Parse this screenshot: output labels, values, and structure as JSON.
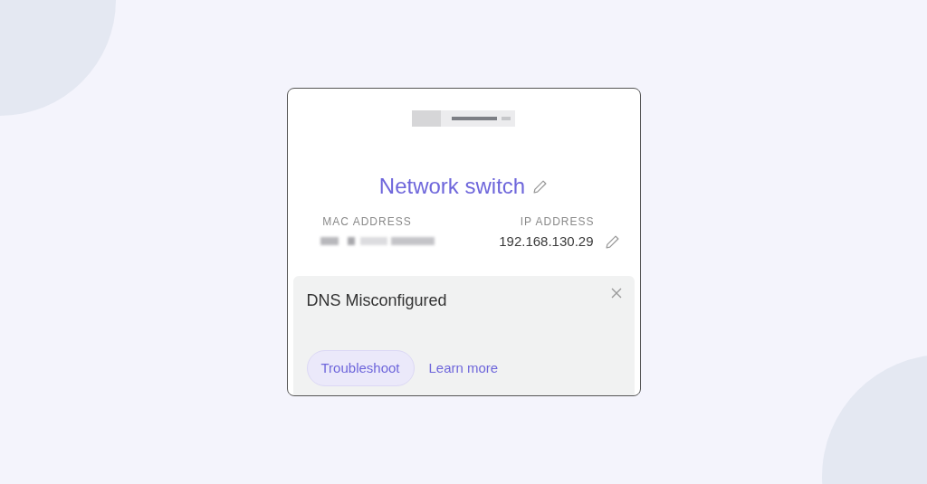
{
  "device": {
    "title": "Network switch"
  },
  "fields": [
    {
      "label": "MAC ADDRESS",
      "kind": "redacted"
    },
    {
      "label": "IP ADDRESS",
      "kind": "editable",
      "value": "192.168.130.29"
    }
  ],
  "alert": {
    "title": "DNS Misconfigured",
    "actions": [
      {
        "label": "Troubleshoot",
        "kind": "pill"
      },
      {
        "label": "Learn more",
        "kind": "link"
      }
    ]
  }
}
